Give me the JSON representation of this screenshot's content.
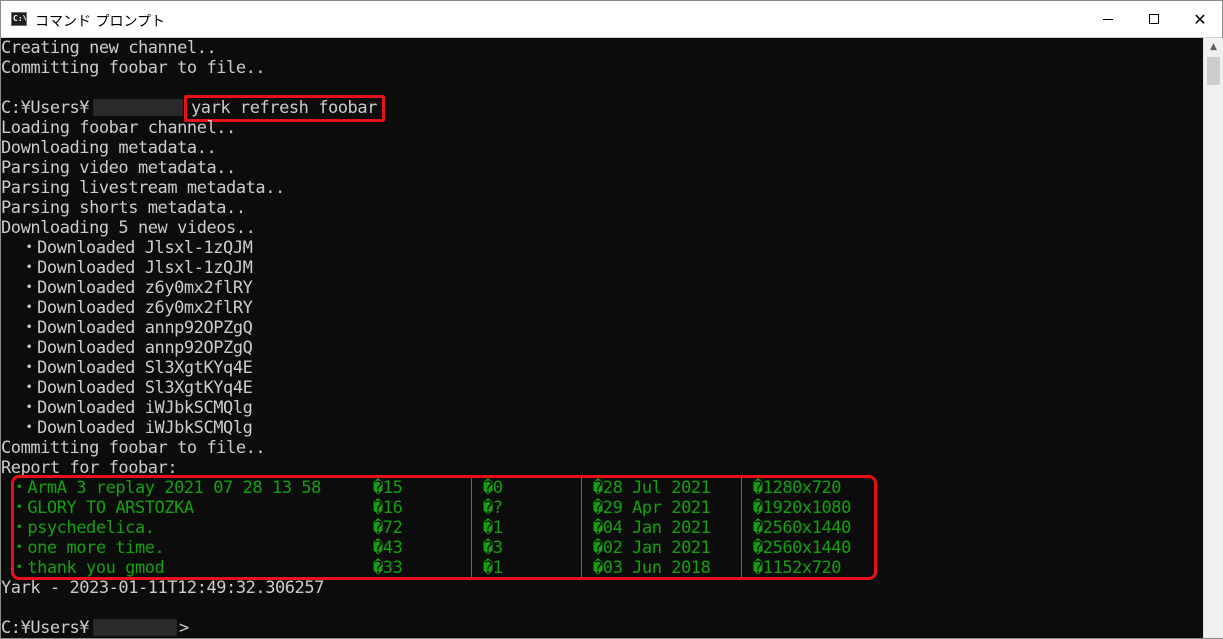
{
  "window": {
    "title": "コマンド プロンプト",
    "icon": "cmd-icon",
    "minimize": "minimize-icon",
    "maximize": "maximize-icon",
    "close": "✕"
  },
  "console": {
    "lines": [
      "Creating new channel..",
      "Committing foobar to file..",
      "",
      "C:¥Users¥",
      "Loading foobar channel..",
      "Downloading metadata..",
      "Parsing video metadata..",
      "Parsing livestream metadata..",
      "Parsing shorts metadata..",
      "Downloading 5 new videos..",
      "  ・Downloaded Jlsxl-1zQJM",
      "  ・Downloaded Jlsxl-1zQJM",
      "  ・Downloaded z6y0mx2flRY",
      "  ・Downloaded z6y0mx2flRY",
      "  ・Downloaded annp92OPZgQ",
      "  ・Downloaded annp92OPZgQ",
      "  ・Downloaded Sl3XgtKYq4E",
      "  ・Downloaded Sl3XgtKYq4E",
      "  ・Downloaded iWJbkSCMQlg",
      "  ・Downloaded iWJbkSCMQlg",
      "Committing foobar to file..",
      "Report for foobar:"
    ],
    "command": "yark refresh foobar",
    "report_rows": [
      {
        "title": " ・ArmA 3 replay 2021 07 28 13 58",
        "views": "�15",
        "likes": "�0",
        "date": "�28 Jul 2021",
        "resolution": "�1280x720"
      },
      {
        "title": " ・GLORY TO ARSTOZKA",
        "views": "�16",
        "likes": "�?",
        "date": "�29 Apr 2021",
        "resolution": "�1920x1080"
      },
      {
        "title": " ・psychedelica.",
        "views": "�72",
        "likes": "�1",
        "date": "�04 Jan 2021",
        "resolution": "�2560x1440"
      },
      {
        "title": " ・one more time.",
        "views": "�43",
        "likes": "�3",
        "date": "�02 Jan 2021",
        "resolution": "�2560x1440"
      },
      {
        "title": " ・thank you gmod",
        "views": "�33",
        "likes": "�1",
        "date": "�03 Jun 2018",
        "resolution": "�1152x720"
      }
    ],
    "footer": "Yark - 2023-01-11T12:49:32.306257",
    "prompt": "C:¥Users¥",
    "prompt_end": ">",
    "colors": {
      "background": "#0c0c0c",
      "text": "#cccccc",
      "green": "#13a10e",
      "highlight": "#e8111a"
    }
  }
}
